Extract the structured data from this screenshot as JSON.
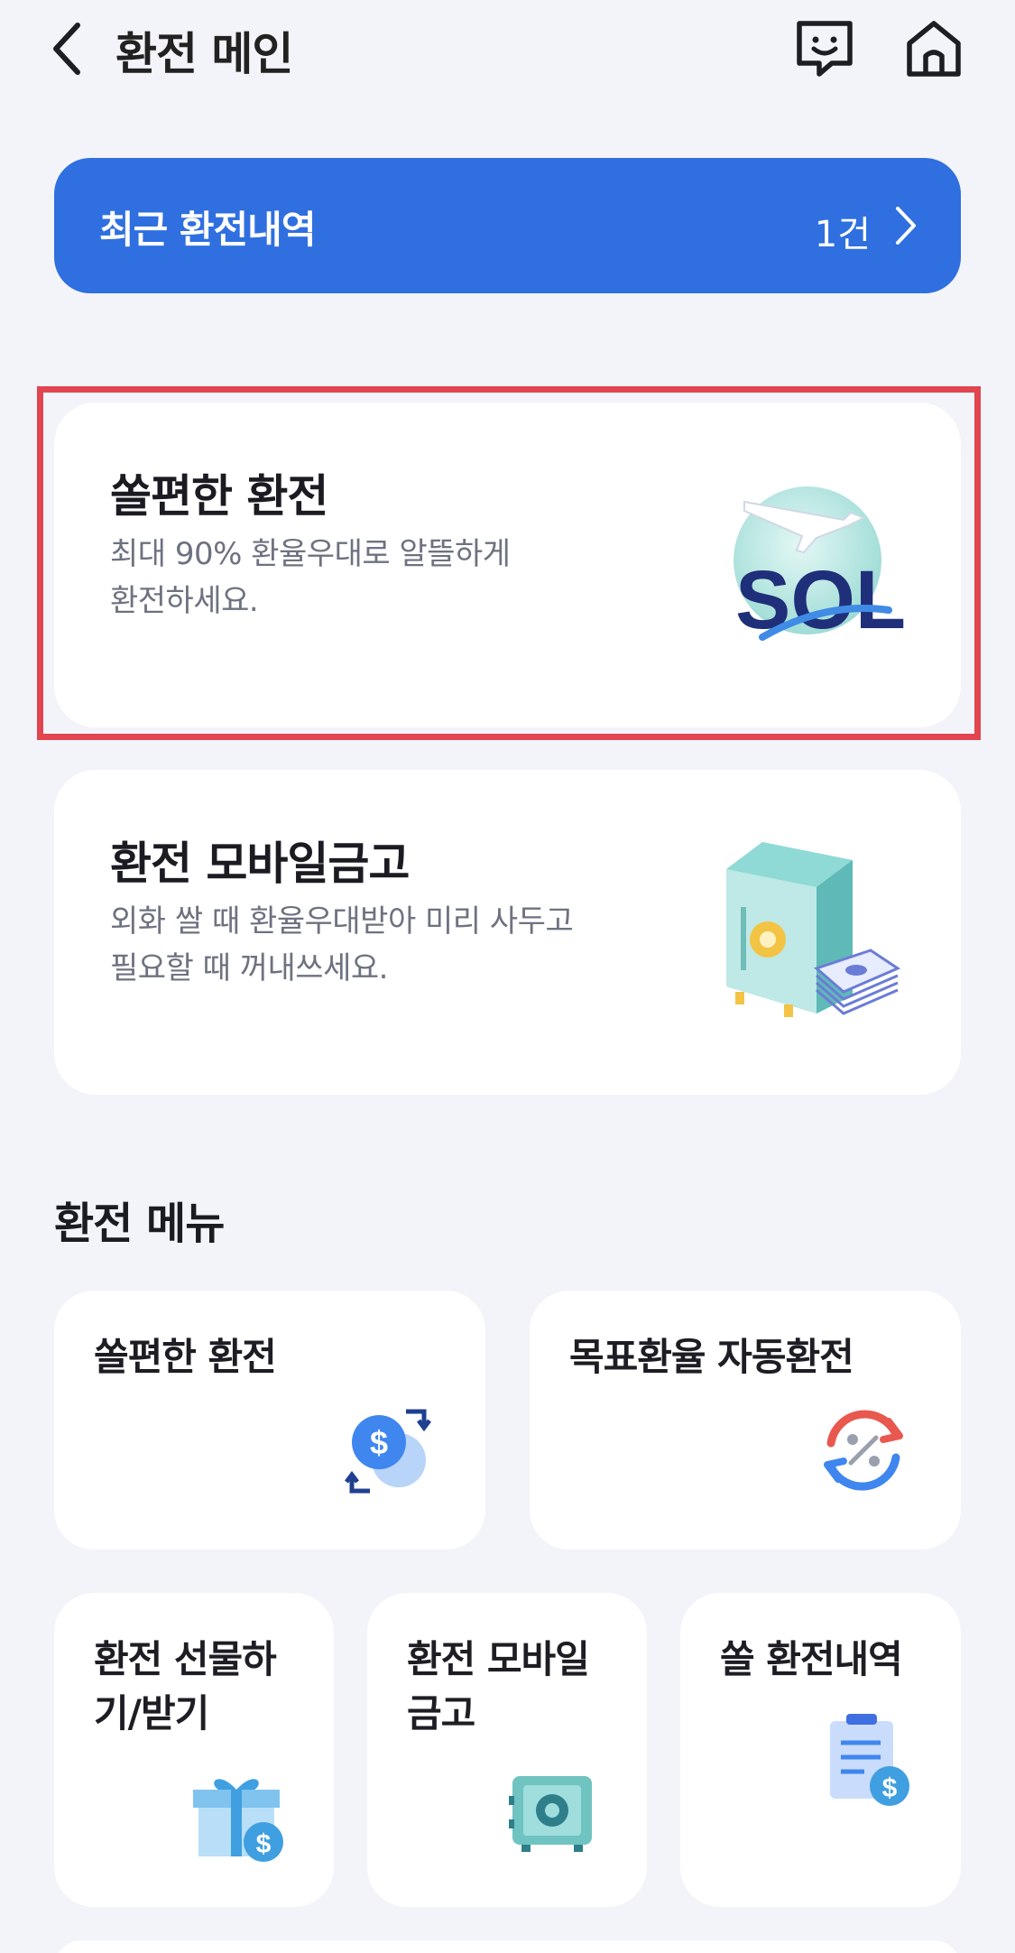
{
  "header": {
    "title": "환전 메인"
  },
  "recent": {
    "label": "최근 환전내역",
    "count": "1건"
  },
  "cards": [
    {
      "title": "쏠편한 환전",
      "desc_line1": "최대 90% 환율우대로 알뜰하게",
      "desc_line2": "환전하세요."
    },
    {
      "title": "환전 모바일금고",
      "desc_line1": "외화 쌀 때 환율우대받아 미리 사두고",
      "desc_line2": "필요할 때 꺼내쓰세요."
    }
  ],
  "menu": {
    "title": "환전 메뉴",
    "items": [
      {
        "line1": "쏠편한 환전",
        "line2": ""
      },
      {
        "line1": "목표환율 자동환전",
        "line2": ""
      },
      {
        "line1": "환전 선물하",
        "line2": "기/받기"
      },
      {
        "line1": "환전 모바일",
        "line2": "금고"
      },
      {
        "line1": "쏠 환전내역",
        "line2": ""
      }
    ]
  },
  "sol_logo": "SOL",
  "colors": {
    "accent": "#2f6fe0",
    "highlight": "#e14550",
    "background": "#f3f4f9"
  },
  "icons": [
    "back-icon",
    "chat-icon",
    "home-icon",
    "chevron-right-icon",
    "sol-globe-icon",
    "safe-icon",
    "exchange-dollar-icon",
    "percent-refresh-icon",
    "gift-icon",
    "safe-small-icon",
    "receipt-icon"
  ]
}
